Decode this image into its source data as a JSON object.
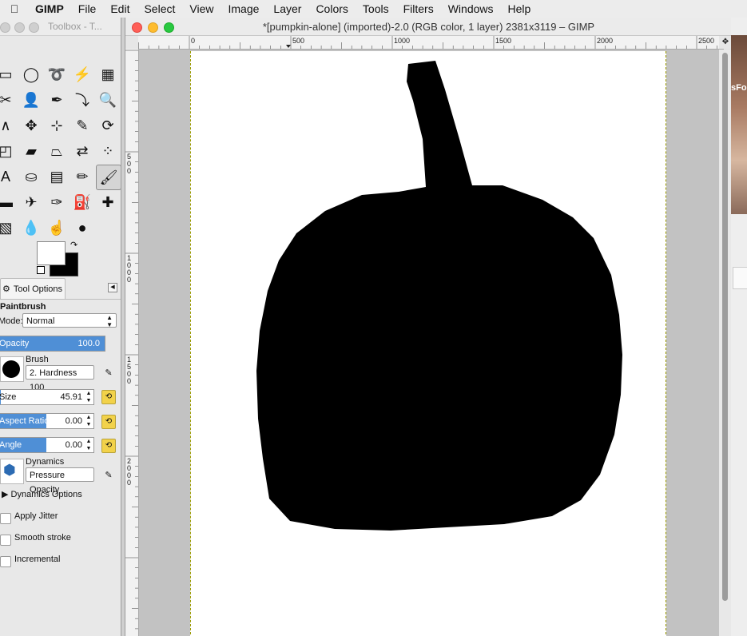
{
  "menubar": {
    "app_name": "GIMP",
    "items": [
      "File",
      "Edit",
      "Select",
      "View",
      "Image",
      "Layer",
      "Colors",
      "Tools",
      "Filters",
      "Windows",
      "Help"
    ]
  },
  "toolbox": {
    "title": "Toolbox - T...",
    "tools": [
      {
        "name": "rect-select-icon",
        "glyph": "▭"
      },
      {
        "name": "ellipse-select-icon",
        "glyph": "◯"
      },
      {
        "name": "free-select-icon",
        "glyph": "➰"
      },
      {
        "name": "fuzzy-select-icon",
        "glyph": "⚡"
      },
      {
        "name": "select-by-color-icon",
        "glyph": "▦"
      },
      {
        "name": "scissors-select-icon",
        "glyph": "✂"
      },
      {
        "name": "foreground-select-icon",
        "glyph": "👤"
      },
      {
        "name": "paths-icon",
        "glyph": "✒"
      },
      {
        "name": "color-picker-icon",
        "glyph": "⤵"
      },
      {
        "name": "zoom-icon",
        "glyph": "🔍"
      },
      {
        "name": "measure-icon",
        "glyph": "∧"
      },
      {
        "name": "move-icon",
        "glyph": "✥"
      },
      {
        "name": "alignment-icon",
        "glyph": "⊹"
      },
      {
        "name": "crop-icon",
        "glyph": "✎"
      },
      {
        "name": "unified-transform-icon",
        "glyph": "⟳"
      },
      {
        "name": "rotate-icon",
        "glyph": "◰"
      },
      {
        "name": "shear-icon",
        "glyph": "▰"
      },
      {
        "name": "perspective-icon",
        "glyph": "⏢"
      },
      {
        "name": "flip-icon",
        "glyph": "⇄"
      },
      {
        "name": "cage-transform-icon",
        "glyph": "⁘"
      },
      {
        "name": "text-icon",
        "glyph": "A"
      },
      {
        "name": "bucket-fill-icon",
        "glyph": "⛀"
      },
      {
        "name": "blend-icon",
        "glyph": "▤"
      },
      {
        "name": "pencil-icon",
        "glyph": "✏"
      },
      {
        "name": "paintbrush-icon",
        "glyph": "🖌"
      },
      {
        "name": "eraser-icon",
        "glyph": "▬"
      },
      {
        "name": "airbrush-icon",
        "glyph": "✈"
      },
      {
        "name": "ink-icon",
        "glyph": "✑"
      },
      {
        "name": "clone-icon",
        "glyph": "⛽"
      },
      {
        "name": "heal-icon",
        "glyph": "✚"
      },
      {
        "name": "perspective-clone-icon",
        "glyph": "▧"
      },
      {
        "name": "blur-icon",
        "glyph": "💧"
      },
      {
        "name": "smudge-icon",
        "glyph": "☝"
      },
      {
        "name": "dodge-burn-icon",
        "glyph": "●"
      }
    ]
  },
  "tool_options": {
    "tab_label": "Tool Options",
    "tool_name": "Paintbrush",
    "mode_label": "Mode:",
    "mode_value": "Normal",
    "opacity_label": "Opacity",
    "opacity_value": "100.0",
    "opacity_fraction": 1.0,
    "brush_label": "Brush",
    "brush_value": "2. Hardness 100",
    "size_label": "Size",
    "size_value": "45.91",
    "size_fraction": 0.02,
    "aspect_label": "Aspect Ratio",
    "aspect_value": "0.00",
    "aspect_fraction": 0.5,
    "angle_label": "Angle",
    "angle_value": "0.00",
    "angle_fraction": 0.5,
    "dynamics_label": "Dynamics",
    "dynamics_value": "Pressure Opacity",
    "dynamics_options_label": "Dynamics Options",
    "apply_jitter_label": "Apply Jitter",
    "smooth_stroke_label": "Smooth stroke",
    "incremental_label": "Incremental"
  },
  "image_window": {
    "title": "*[pumpkin-alone] (imported)-2.0 (RGB color, 1 layer) 2381x3119 – GIMP",
    "ruler_top_labels": [
      "0",
      "500",
      "1000",
      "1500",
      "2000",
      "2500"
    ],
    "ruler_left_labels": [
      "500",
      "1000",
      "1500",
      "2000"
    ]
  },
  "background_window": {
    "visible_text": "sFo"
  },
  "colors": {
    "accent": "#4f8fd6",
    "close": "#ff5f57",
    "minimize": "#febc2e",
    "zoom": "#28c840"
  }
}
